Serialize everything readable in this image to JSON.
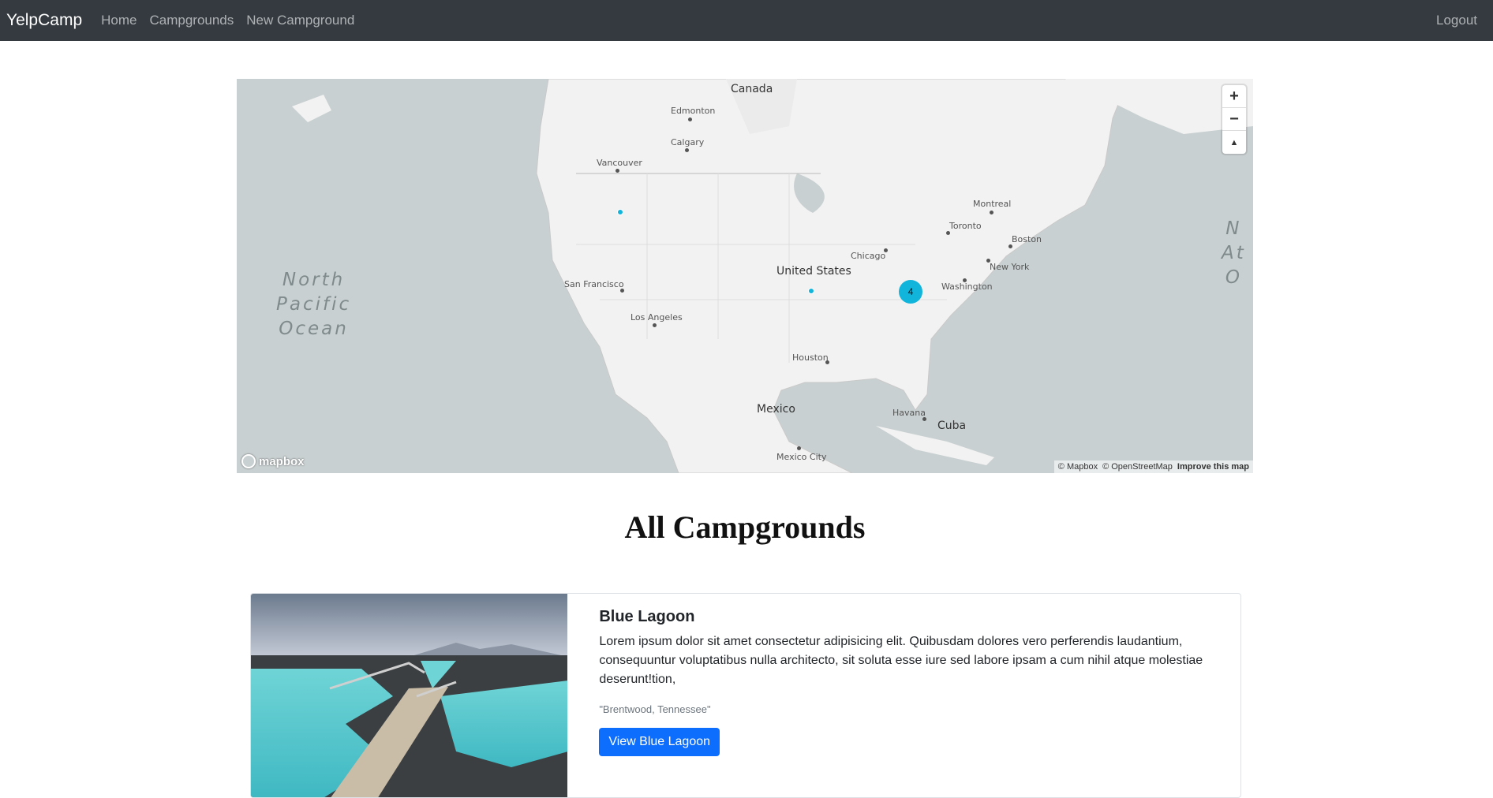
{
  "nav": {
    "brand": "YelpCamp",
    "links": [
      "Home",
      "Campgrounds",
      "New Campground"
    ],
    "logout": "Logout"
  },
  "map": {
    "countries": [
      "Canada",
      "United States",
      "Mexico",
      "Cuba"
    ],
    "oceans": {
      "pacific": "North\nPacific\nOcean",
      "atlantic": "N\nAt\nO"
    },
    "cities": [
      "Edmonton",
      "Calgary",
      "Vancouver",
      "Montreal",
      "Toronto",
      "Boston",
      "Chicago",
      "New York",
      "Washington",
      "San Francisco",
      "Los Angeles",
      "Houston",
      "Havana",
      "Mexico City"
    ],
    "cluster_count": "4",
    "controls": {
      "zoom_in": "+",
      "zoom_out": "−",
      "compass": "▲"
    },
    "logo": "mapbox",
    "attribution": {
      "mapbox": "© Mapbox",
      "osm": "© OpenStreetMap",
      "improve": "Improve this map"
    },
    "pin_color": "#11b4da"
  },
  "page": {
    "title": "All Campgrounds"
  },
  "campgrounds": [
    {
      "title": "Blue Lagoon",
      "description": "Lorem ipsum dolor sit amet consectetur adipisicing elit. Quibusdam dolores vero perferendis laudantium, consequuntur voluptatibus nulla architecto, sit soluta esse iure sed labore ipsam a cum nihil atque molestiae deserunt!tion,",
      "location": "\"Brentwood, Tennessee\"",
      "button": "View Blue Lagoon"
    }
  ]
}
